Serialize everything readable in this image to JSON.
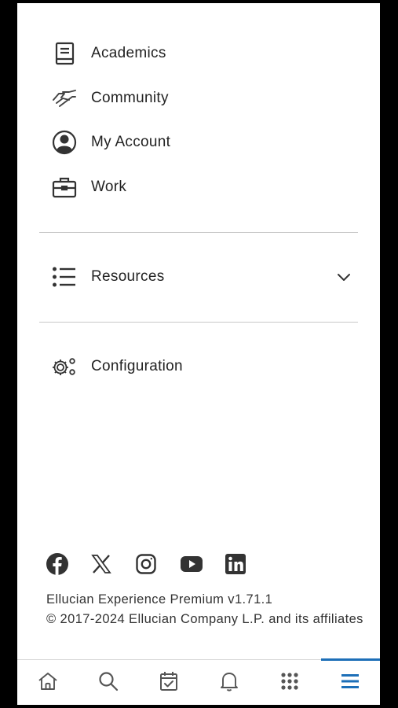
{
  "menu": {
    "items": [
      {
        "label": "Academics",
        "icon": "book-icon"
      },
      {
        "label": "Community",
        "icon": "handshake-icon"
      },
      {
        "label": "My Account",
        "icon": "account-circle-icon"
      },
      {
        "label": "Work",
        "icon": "briefcase-icon"
      }
    ],
    "resources": {
      "label": "Resources",
      "icon": "list-icon",
      "expanded": false
    },
    "configuration": {
      "label": "Configuration",
      "icon": "gears-icon"
    }
  },
  "social": [
    "facebook-icon",
    "x-icon",
    "instagram-icon",
    "youtube-icon",
    "linkedin-icon"
  ],
  "footer": {
    "version": "Ellucian Experience Premium v1.71.1",
    "copyright": "© 2017-2024 Ellucian Company L.P. and its affiliates"
  },
  "tabbar": {
    "tabs": [
      "home-icon",
      "search-icon",
      "calendar-check-icon",
      "bell-icon",
      "grid-icon",
      "menu-icon"
    ],
    "active_index": 5,
    "accent": "#1d6fb8"
  }
}
